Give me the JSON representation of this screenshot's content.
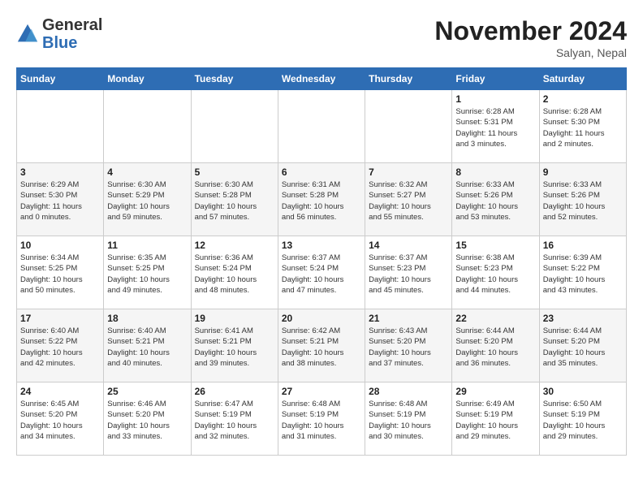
{
  "header": {
    "logo_general": "General",
    "logo_blue": "Blue",
    "month_title": "November 2024",
    "location": "Salyan, Nepal"
  },
  "weekdays": [
    "Sunday",
    "Monday",
    "Tuesday",
    "Wednesday",
    "Thursday",
    "Friday",
    "Saturday"
  ],
  "weeks": [
    [
      {
        "day": "",
        "info": ""
      },
      {
        "day": "",
        "info": ""
      },
      {
        "day": "",
        "info": ""
      },
      {
        "day": "",
        "info": ""
      },
      {
        "day": "",
        "info": ""
      },
      {
        "day": "1",
        "info": "Sunrise: 6:28 AM\nSunset: 5:31 PM\nDaylight: 11 hours\nand 3 minutes."
      },
      {
        "day": "2",
        "info": "Sunrise: 6:28 AM\nSunset: 5:30 PM\nDaylight: 11 hours\nand 2 minutes."
      }
    ],
    [
      {
        "day": "3",
        "info": "Sunrise: 6:29 AM\nSunset: 5:30 PM\nDaylight: 11 hours\nand 0 minutes."
      },
      {
        "day": "4",
        "info": "Sunrise: 6:30 AM\nSunset: 5:29 PM\nDaylight: 10 hours\nand 59 minutes."
      },
      {
        "day": "5",
        "info": "Sunrise: 6:30 AM\nSunset: 5:28 PM\nDaylight: 10 hours\nand 57 minutes."
      },
      {
        "day": "6",
        "info": "Sunrise: 6:31 AM\nSunset: 5:28 PM\nDaylight: 10 hours\nand 56 minutes."
      },
      {
        "day": "7",
        "info": "Sunrise: 6:32 AM\nSunset: 5:27 PM\nDaylight: 10 hours\nand 55 minutes."
      },
      {
        "day": "8",
        "info": "Sunrise: 6:33 AM\nSunset: 5:26 PM\nDaylight: 10 hours\nand 53 minutes."
      },
      {
        "day": "9",
        "info": "Sunrise: 6:33 AM\nSunset: 5:26 PM\nDaylight: 10 hours\nand 52 minutes."
      }
    ],
    [
      {
        "day": "10",
        "info": "Sunrise: 6:34 AM\nSunset: 5:25 PM\nDaylight: 10 hours\nand 50 minutes."
      },
      {
        "day": "11",
        "info": "Sunrise: 6:35 AM\nSunset: 5:25 PM\nDaylight: 10 hours\nand 49 minutes."
      },
      {
        "day": "12",
        "info": "Sunrise: 6:36 AM\nSunset: 5:24 PM\nDaylight: 10 hours\nand 48 minutes."
      },
      {
        "day": "13",
        "info": "Sunrise: 6:37 AM\nSunset: 5:24 PM\nDaylight: 10 hours\nand 47 minutes."
      },
      {
        "day": "14",
        "info": "Sunrise: 6:37 AM\nSunset: 5:23 PM\nDaylight: 10 hours\nand 45 minutes."
      },
      {
        "day": "15",
        "info": "Sunrise: 6:38 AM\nSunset: 5:23 PM\nDaylight: 10 hours\nand 44 minutes."
      },
      {
        "day": "16",
        "info": "Sunrise: 6:39 AM\nSunset: 5:22 PM\nDaylight: 10 hours\nand 43 minutes."
      }
    ],
    [
      {
        "day": "17",
        "info": "Sunrise: 6:40 AM\nSunset: 5:22 PM\nDaylight: 10 hours\nand 42 minutes."
      },
      {
        "day": "18",
        "info": "Sunrise: 6:40 AM\nSunset: 5:21 PM\nDaylight: 10 hours\nand 40 minutes."
      },
      {
        "day": "19",
        "info": "Sunrise: 6:41 AM\nSunset: 5:21 PM\nDaylight: 10 hours\nand 39 minutes."
      },
      {
        "day": "20",
        "info": "Sunrise: 6:42 AM\nSunset: 5:21 PM\nDaylight: 10 hours\nand 38 minutes."
      },
      {
        "day": "21",
        "info": "Sunrise: 6:43 AM\nSunset: 5:20 PM\nDaylight: 10 hours\nand 37 minutes."
      },
      {
        "day": "22",
        "info": "Sunrise: 6:44 AM\nSunset: 5:20 PM\nDaylight: 10 hours\nand 36 minutes."
      },
      {
        "day": "23",
        "info": "Sunrise: 6:44 AM\nSunset: 5:20 PM\nDaylight: 10 hours\nand 35 minutes."
      }
    ],
    [
      {
        "day": "24",
        "info": "Sunrise: 6:45 AM\nSunset: 5:20 PM\nDaylight: 10 hours\nand 34 minutes."
      },
      {
        "day": "25",
        "info": "Sunrise: 6:46 AM\nSunset: 5:20 PM\nDaylight: 10 hours\nand 33 minutes."
      },
      {
        "day": "26",
        "info": "Sunrise: 6:47 AM\nSunset: 5:19 PM\nDaylight: 10 hours\nand 32 minutes."
      },
      {
        "day": "27",
        "info": "Sunrise: 6:48 AM\nSunset: 5:19 PM\nDaylight: 10 hours\nand 31 minutes."
      },
      {
        "day": "28",
        "info": "Sunrise: 6:48 AM\nSunset: 5:19 PM\nDaylight: 10 hours\nand 30 minutes."
      },
      {
        "day": "29",
        "info": "Sunrise: 6:49 AM\nSunset: 5:19 PM\nDaylight: 10 hours\nand 29 minutes."
      },
      {
        "day": "30",
        "info": "Sunrise: 6:50 AM\nSunset: 5:19 PM\nDaylight: 10 hours\nand 29 minutes."
      }
    ]
  ]
}
